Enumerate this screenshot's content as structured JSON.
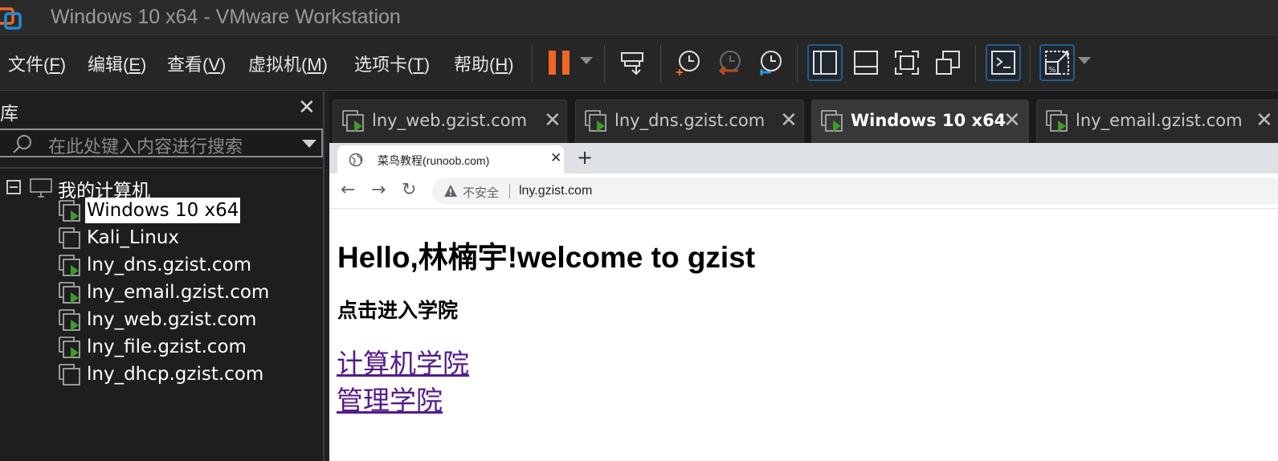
{
  "window": {
    "title": "Windows 10 x64 - VMware Workstation"
  },
  "menu": {
    "items": [
      {
        "label": "文件(",
        "key": "F",
        "end": ")"
      },
      {
        "label": "编辑(",
        "key": "E",
        "end": ")"
      },
      {
        "label": "查看(",
        "key": "V",
        "end": ")"
      },
      {
        "label": "虚拟机(",
        "key": "M",
        "end": ")"
      },
      {
        "label": "选项卡(",
        "key": "T",
        "end": ")"
      },
      {
        "label": "帮助(",
        "key": "H",
        "end": ")"
      }
    ]
  },
  "colors": {
    "pause": "#f26522",
    "play": "#3f9b2e",
    "accent_blue": "#2e5a86",
    "link_visited": "#551a8b"
  },
  "library": {
    "title": "库",
    "search_placeholder": "在此处键入内容进行搜索",
    "root_label": "我的计算机",
    "vms": [
      {
        "name": "Windows 10 x64",
        "running": true,
        "selected": true
      },
      {
        "name": "Kali_Linux",
        "running": false,
        "selected": false
      },
      {
        "name": "lny_dns.gzist.com",
        "running": true,
        "selected": false
      },
      {
        "name": "lny_email.gzist.com",
        "running": true,
        "selected": false
      },
      {
        "name": "lny_web.gzist.com",
        "running": true,
        "selected": false
      },
      {
        "name": "lny_file.gzist.com",
        "running": true,
        "selected": false
      },
      {
        "name": "lny_dhcp.gzist.com",
        "running": false,
        "selected": false
      }
    ]
  },
  "tabs": [
    {
      "label": "lny_web.gzist.com",
      "active": false
    },
    {
      "label": "lny_dns.gzist.com",
      "active": false
    },
    {
      "label": "Windows 10 x64",
      "active": true
    },
    {
      "label": "lny_email.gzist.com",
      "active": false
    }
  ],
  "browser": {
    "tab_title": "菜鸟教程(runoob.com)",
    "security_label": "不安全",
    "url": "lny.gzist.com"
  },
  "page": {
    "heading": "Hello,林楠宇!welcome to gzist",
    "subheading": "点击进入学院",
    "links": [
      "计算机学院",
      "管理学院"
    ]
  }
}
